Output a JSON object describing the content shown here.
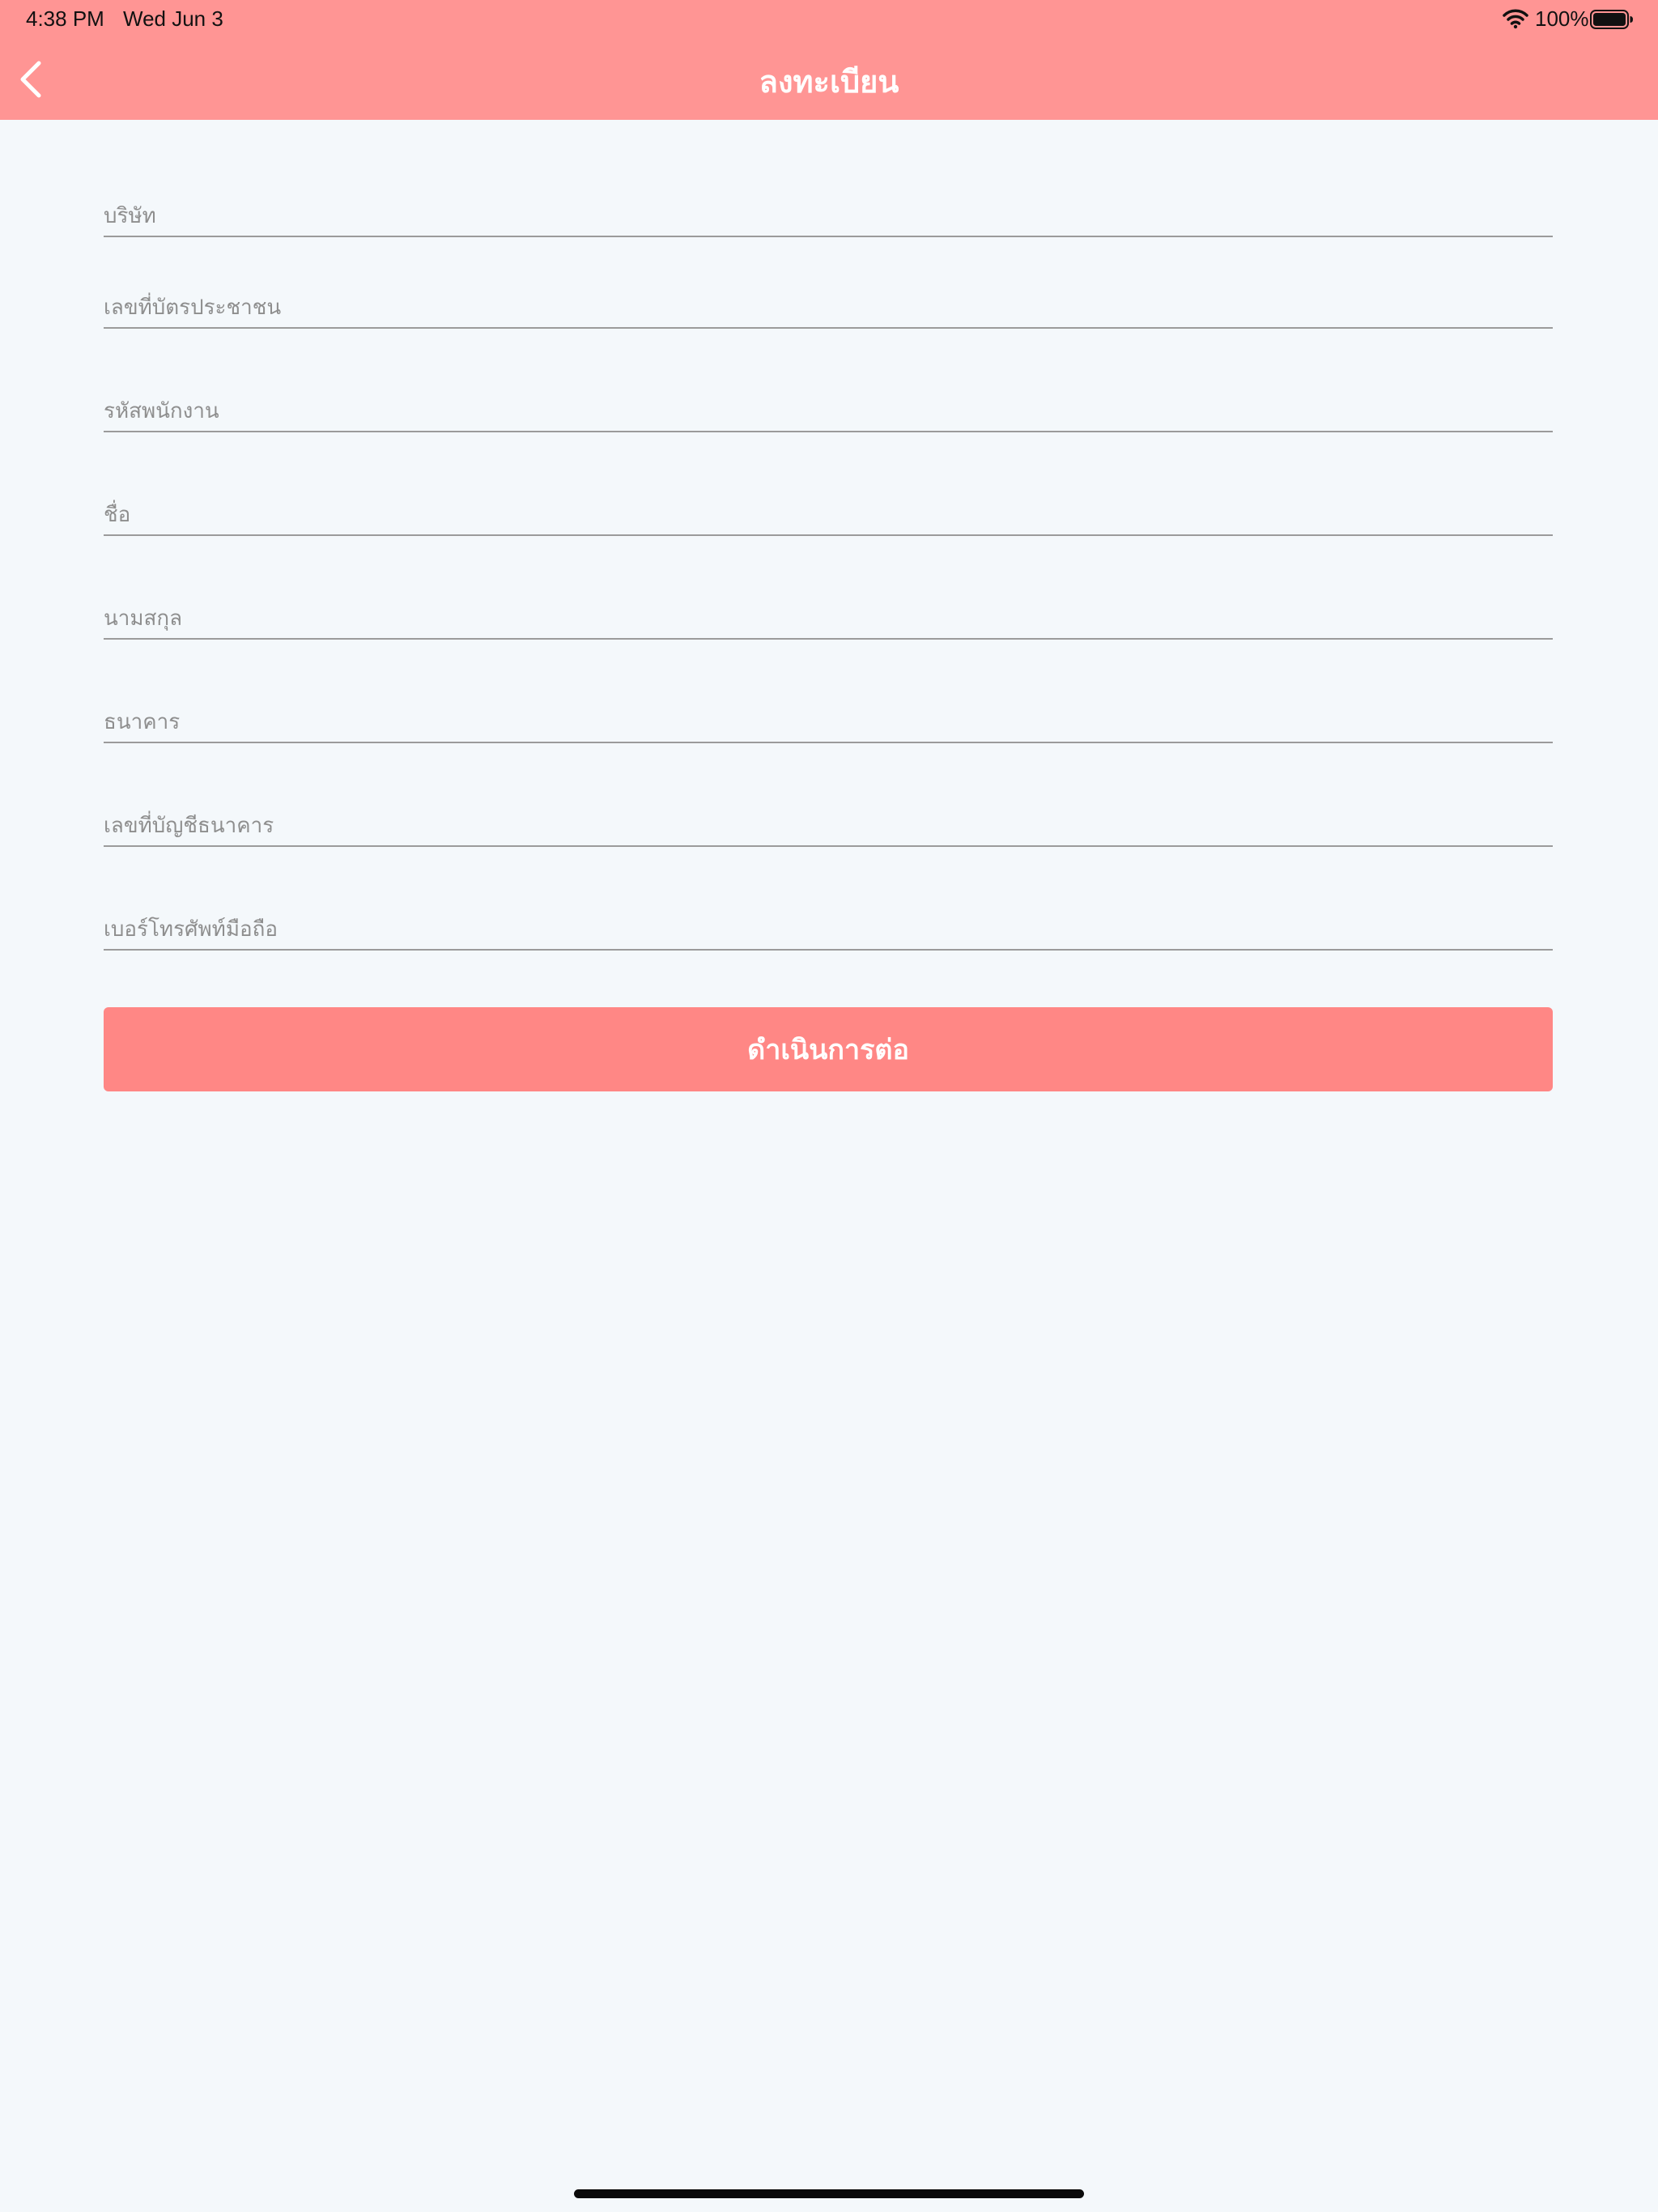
{
  "status_bar": {
    "time": "4:38 PM",
    "date": "Wed Jun 3",
    "battery_percent": "100%",
    "battery_level": 1.0,
    "icons": [
      "wifi-icon",
      "battery-icon"
    ]
  },
  "nav": {
    "title": "ลงทะเบียน",
    "back_icon": "chevron-left-icon"
  },
  "form": {
    "fields": [
      {
        "placeholder": "บริษัท",
        "value": ""
      },
      {
        "placeholder": "เลขที่บัตรประชาชน",
        "value": ""
      },
      {
        "placeholder": "รหัสพนักงาน",
        "value": ""
      },
      {
        "placeholder": "ชื่อ",
        "value": ""
      },
      {
        "placeholder": "นามสกุล",
        "value": ""
      },
      {
        "placeholder": "ธนาคาร",
        "value": ""
      },
      {
        "placeholder": "เลขที่บัญชีธนาคาร",
        "value": ""
      },
      {
        "placeholder": "เบอร์โทรศัพท์มือถือ",
        "value": ""
      }
    ],
    "submit_label": "ดำเนินการต่อ"
  },
  "colors": {
    "nav_background": "#ff9594",
    "button_background": "#ff8785",
    "page_background": "#f4f8fb",
    "field_underline": "#9b9b9b"
  }
}
